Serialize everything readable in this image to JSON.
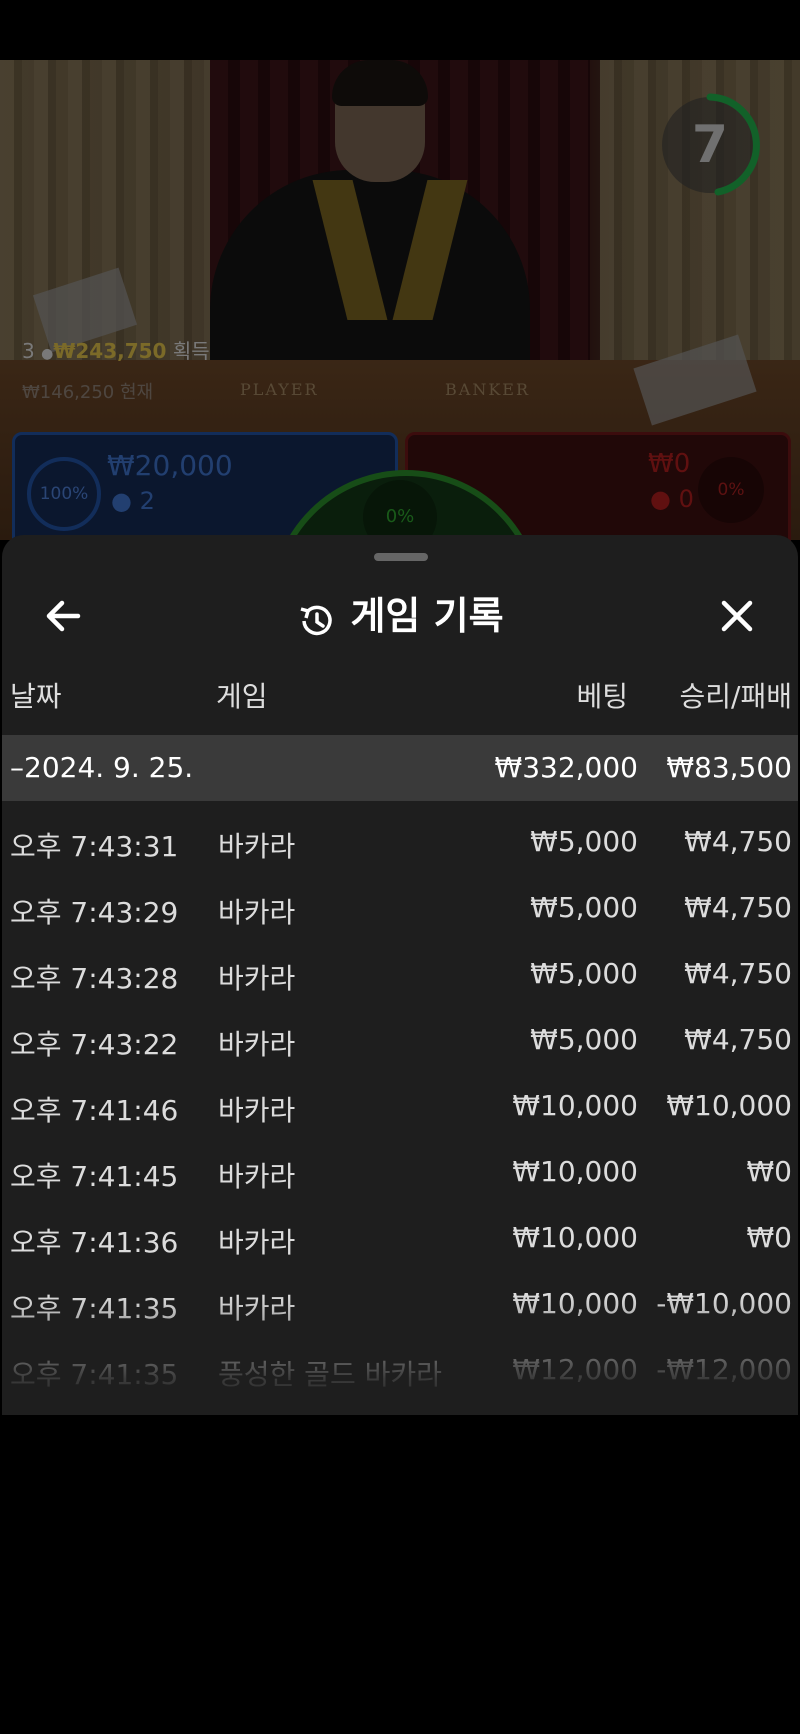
{
  "video": {
    "timer": "7",
    "win_count": "3",
    "win_amount": "₩243,750",
    "win_label": "획득",
    "secondary_info": "₩146,250  현재",
    "table_player_label": "PLAYER",
    "table_banker_label": "BANKER"
  },
  "bets": {
    "player": {
      "percent": "100%",
      "amount": "₩20,000",
      "players": "2"
    },
    "tie": {
      "percent": "0%"
    },
    "banker": {
      "percent": "0%",
      "amount": "₩0",
      "players": "0"
    }
  },
  "history": {
    "title": "게임 기록",
    "columns": {
      "date": "날짜",
      "game": "게임",
      "bet": "베팅",
      "result": "승리/패배"
    },
    "date_group": {
      "date": "–2024. 9. 25.",
      "total_bet": "₩332,000",
      "total_result": "₩83,500"
    },
    "rows": [
      {
        "time": "오후 7:43:31",
        "game": "바카라",
        "bet": "₩5,000",
        "result": "₩4,750"
      },
      {
        "time": "오후 7:43:29",
        "game": "바카라",
        "bet": "₩5,000",
        "result": "₩4,750"
      },
      {
        "time": "오후 7:43:28",
        "game": "바카라",
        "bet": "₩5,000",
        "result": "₩4,750"
      },
      {
        "time": "오후 7:43:22",
        "game": "바카라",
        "bet": "₩5,000",
        "result": "₩4,750"
      },
      {
        "time": "오후 7:41:46",
        "game": "바카라",
        "bet": "₩10,000",
        "result": "₩10,000"
      },
      {
        "time": "오후 7:41:45",
        "game": "바카라",
        "bet": "₩10,000",
        "result": "₩0"
      },
      {
        "time": "오후 7:41:36",
        "game": "바카라",
        "bet": "₩10,000",
        "result": "₩0"
      },
      {
        "time": "오후 7:41:35",
        "game": "바카라",
        "bet": "₩10,000",
        "result": "-₩10,000"
      },
      {
        "time": "오후 7:41:35",
        "game": "풍성한 골드 바카라",
        "bet": "₩12,000",
        "result": "-₩12,000"
      }
    ]
  },
  "icons": {
    "back": "arrow-left-icon",
    "history": "history-clock-icon",
    "close": "close-icon",
    "user": "user-icon"
  },
  "colors": {
    "player": "#2153a5",
    "banker": "#6e1618",
    "tie": "#2a8d2a",
    "timer": "#22b14c",
    "win_amount": "#e0c14a"
  }
}
